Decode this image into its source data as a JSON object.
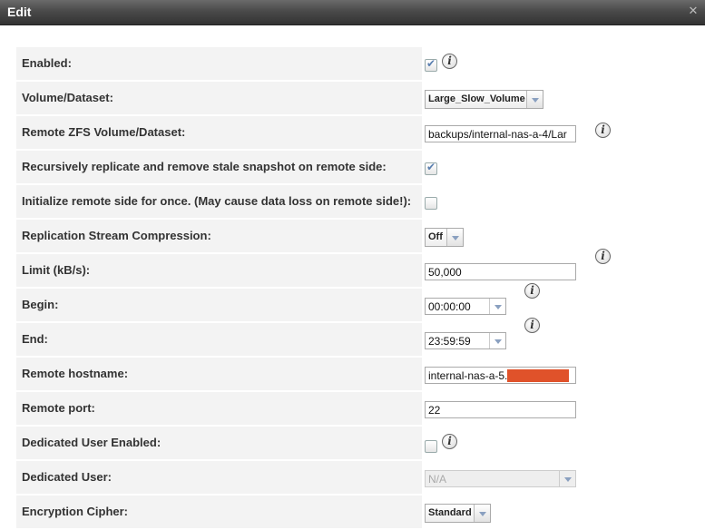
{
  "window": {
    "title": "Edit",
    "close_icon": "close-icon"
  },
  "fields": {
    "enabled": {
      "label": "Enabled:",
      "checked": true
    },
    "volume": {
      "label": "Volume/Dataset:",
      "value": "Large_Slow_Volume"
    },
    "remote_volume": {
      "label": "Remote ZFS Volume/Dataset:",
      "value": "backups/internal-nas-a-4/Lar"
    },
    "recursive": {
      "label": "Recursively replicate and remove stale snapshot on remote side:",
      "checked": true
    },
    "initialize": {
      "label": "Initialize remote side for once. (May cause data loss on remote side!):",
      "checked": false
    },
    "compression": {
      "label": "Replication Stream Compression:",
      "value": "Off"
    },
    "limit": {
      "label": "Limit (kB/s):",
      "value": "50,000"
    },
    "begin": {
      "label": "Begin:",
      "value": "00:00:00"
    },
    "end": {
      "label": "End:",
      "value": "23:59:59"
    },
    "remote_hostname": {
      "label": "Remote hostname:",
      "value": "internal-nas-a-5."
    },
    "remote_port": {
      "label": "Remote port:",
      "value": "22"
    },
    "dedicated_user_enabled": {
      "label": "Dedicated User Enabled:",
      "checked": false
    },
    "dedicated_user": {
      "label": "Dedicated User:",
      "value": "N/A"
    },
    "cipher": {
      "label": "Encryption Cipher:",
      "value": "Standard"
    }
  },
  "colors": {
    "redaction": "#e0522a",
    "titlebar": "#4a4a4a",
    "label_bg": "#f3f3f3"
  }
}
